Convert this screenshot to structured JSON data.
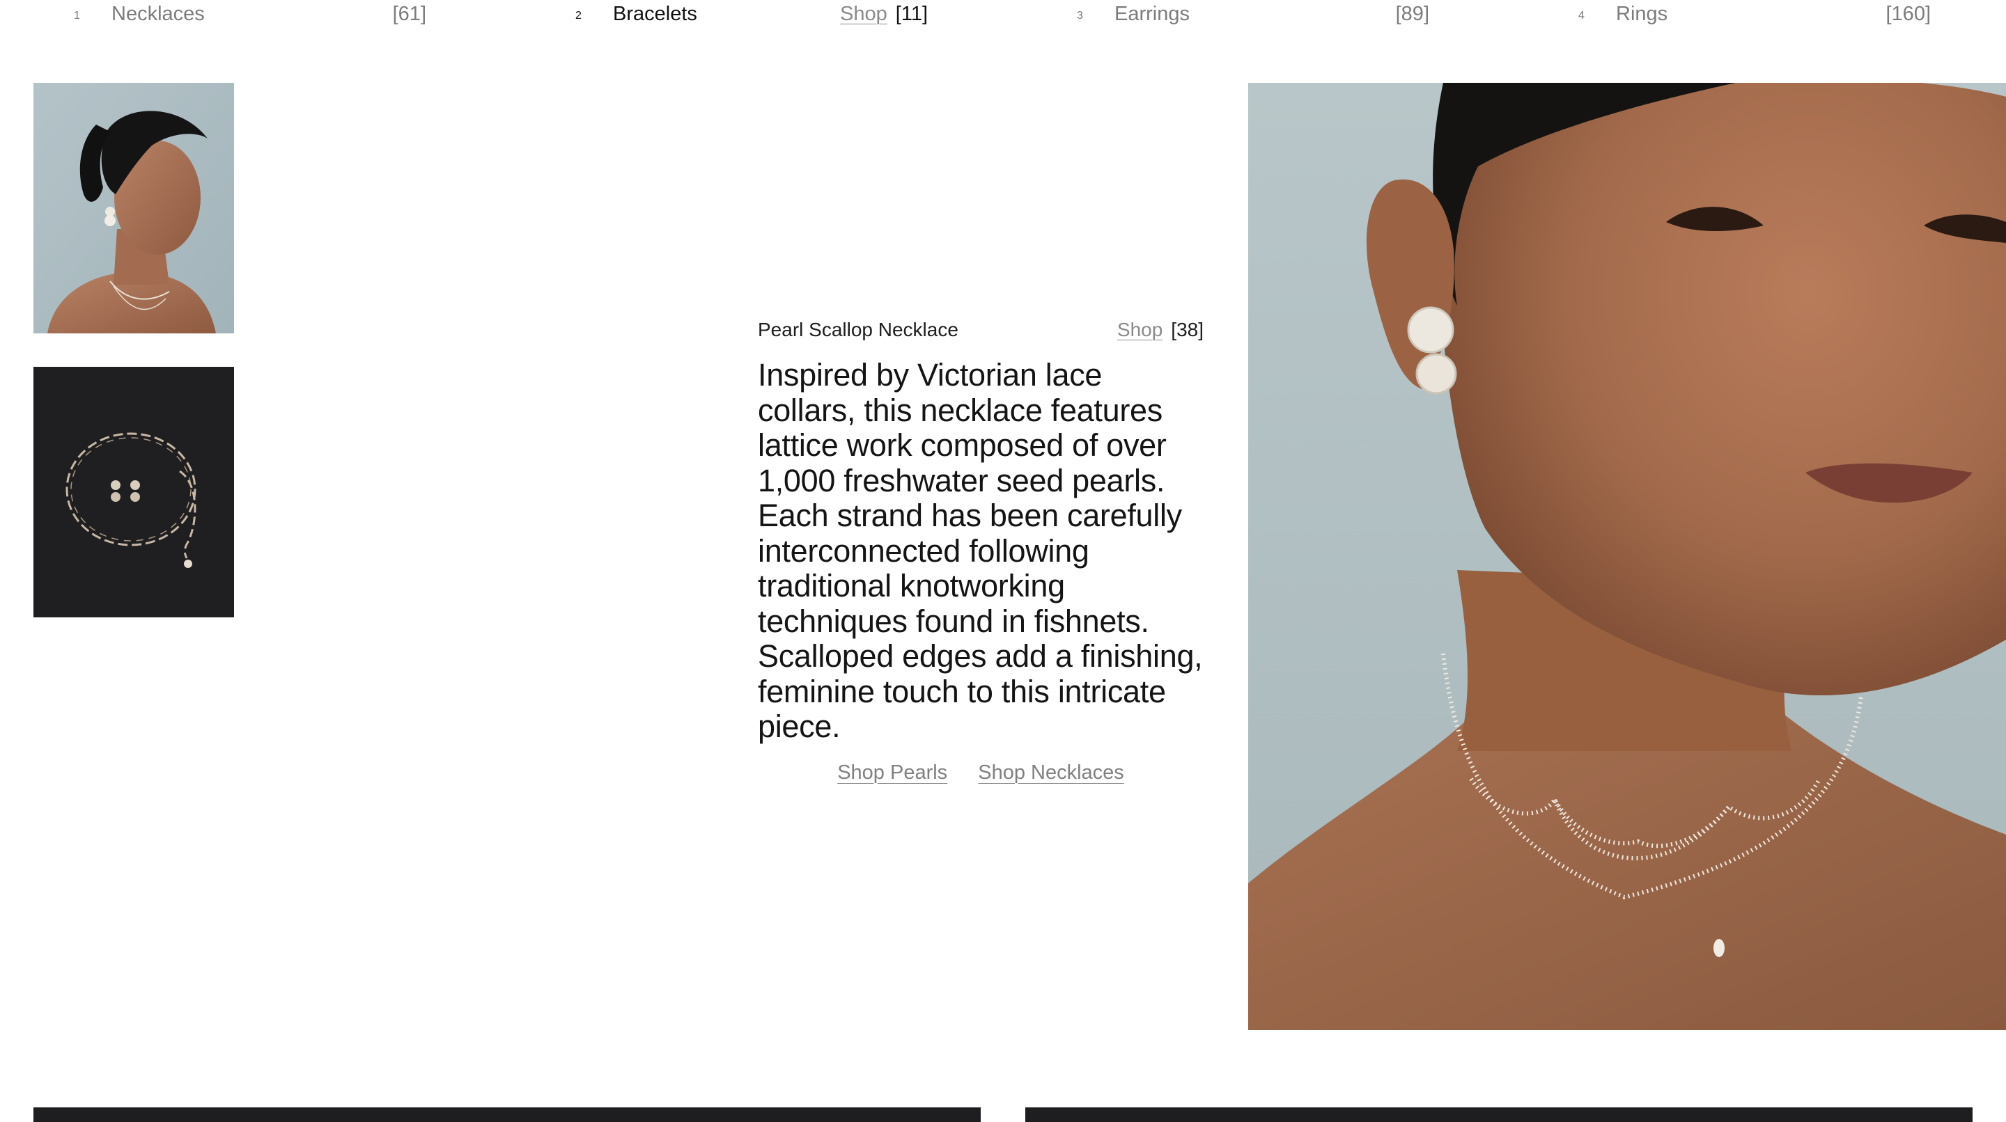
{
  "categories": [
    {
      "num": "1",
      "label": "Necklaces",
      "shop": "",
      "count": "[61]",
      "active": false
    },
    {
      "num": "2",
      "label": "Bracelets",
      "shop": "Shop",
      "count": "[11]",
      "active": true
    },
    {
      "num": "3",
      "label": "Earrings",
      "shop": "",
      "count": "[89]",
      "active": false
    },
    {
      "num": "4",
      "label": "Rings",
      "shop": "",
      "count": "[160]",
      "active": false
    }
  ],
  "product": {
    "title": "Pearl Scallop Necklace",
    "shop_label": "Shop",
    "count": "[38]",
    "description": "Inspired by Victorian lace collars, this necklace features lattice work composed of over 1,000 freshwater seed pearls. Each strand has been carefully interconnected following traditional knotworking techniques found in fishnets. Scalloped edges add a finishing, feminine touch to this intricate piece.",
    "links": [
      "Shop Pearls",
      "Shop Necklaces"
    ]
  },
  "colors": {
    "background": "#ffffff",
    "text": "#141414",
    "muted": "#7c7c7c",
    "thumb_light_bg": "#a9b9bf",
    "thumb_dark_bg": "#1c1c1e",
    "hero_bg": "#b3c1c4",
    "skin": "#a9704f"
  },
  "images": {
    "thumb1": "model-profile-photo",
    "thumb2": "necklace-flatlay-photo",
    "hero": "model-closeup-photo"
  }
}
